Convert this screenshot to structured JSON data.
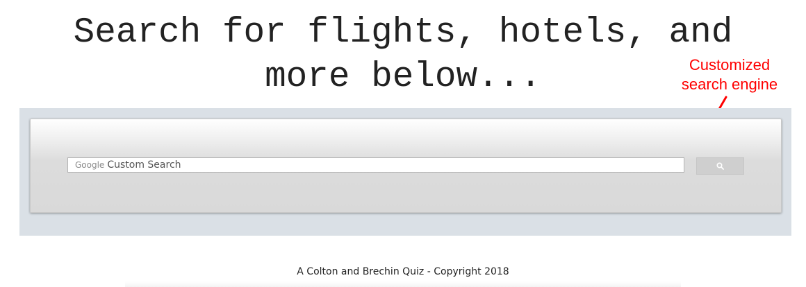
{
  "headline": {
    "line1": "Search for flights, hotels, and",
    "line2": "more below..."
  },
  "annotation": {
    "line1": "Customized",
    "line2": "search engine",
    "color": "#ff0000"
  },
  "search": {
    "brand": "Google",
    "placeholder": "Custom Search",
    "button_icon": "search-icon"
  },
  "footer": {
    "text": "A Colton and Brechin Quiz - Copyright 2018"
  },
  "colors": {
    "band_background": "#dae0e6",
    "headline_text": "#222222",
    "annotation_red": "#ff0000"
  }
}
